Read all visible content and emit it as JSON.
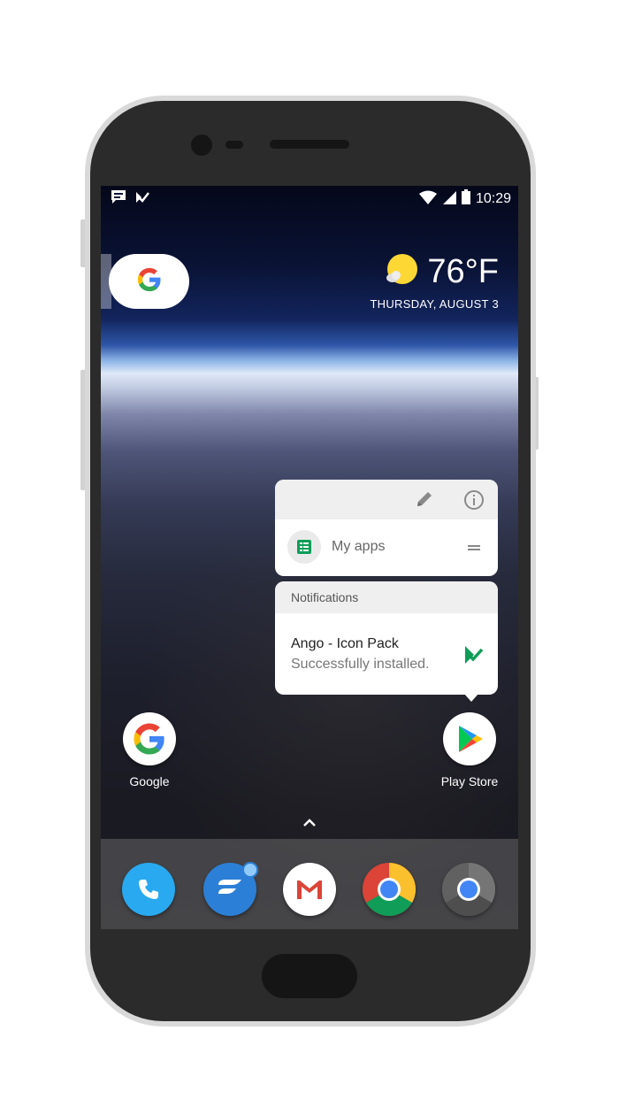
{
  "status_bar": {
    "time": "10:29",
    "left_icons": [
      "message-icon",
      "ango-icon"
    ],
    "right_icons": [
      "wifi-icon",
      "signal-icon",
      "battery-icon"
    ]
  },
  "search_widget": {
    "icon": "google-g-icon"
  },
  "weather": {
    "temperature": "76°F",
    "date": "THURSDAY, AUGUST 3",
    "icon": "partly-sunny-icon"
  },
  "shortcut_popup": {
    "edit_icon": "pencil-icon",
    "info_icon": "info-icon",
    "shortcut_label": "My apps",
    "shortcut_icon": "my-apps-icon"
  },
  "notifications_popup": {
    "header": "Notifications",
    "title": "Ango - Icon Pack",
    "subtitle": "Successfully installed.",
    "icon": "ango-icon"
  },
  "home_apps": [
    {
      "label": "Google",
      "icon": "google-icon"
    },
    {
      "label": "Play Store",
      "icon": "play-store-icon"
    }
  ],
  "dock": [
    {
      "name": "phone",
      "icon": "phone-icon",
      "color": "#2196f3"
    },
    {
      "name": "fluid-app",
      "icon": "fluid-icon",
      "color": "#1e88e5"
    },
    {
      "name": "gmail",
      "icon": "gmail-icon",
      "color": "#ffffff"
    },
    {
      "name": "chrome",
      "icon": "chrome-icon",
      "color": "#db4437"
    },
    {
      "name": "chrome-dev",
      "icon": "chrome-dev-icon",
      "color": "#616161"
    }
  ]
}
